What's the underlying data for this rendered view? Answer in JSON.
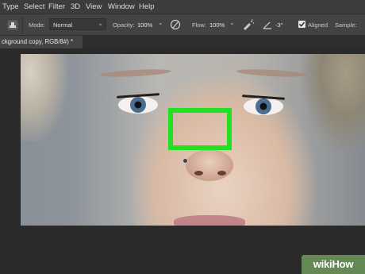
{
  "menubar": {
    "items": [
      "Type",
      "Select",
      "Filter",
      "3D",
      "View",
      "Window",
      "Help"
    ]
  },
  "options": {
    "mode_label": "Mode:",
    "mode_value": "Normal",
    "opacity_label": "Opacity:",
    "opacity_value": "100%",
    "flow_label": "Flow:",
    "flow_value": "100%",
    "angle_value": "-3°",
    "aligned_label": "Aligned",
    "sample_label": "Sample:"
  },
  "tab": {
    "title": "ckground copy, RGB/8#) *",
    "close": "×"
  },
  "watermark": {
    "text": "wikiHow"
  },
  "colors": {
    "highlight": "#22e022",
    "menubar": "#3c3c3c",
    "options_bar": "#434343"
  }
}
